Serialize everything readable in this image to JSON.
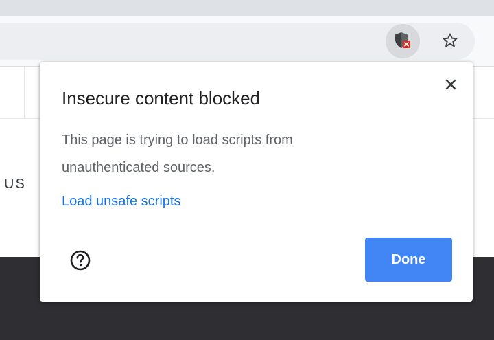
{
  "toolbar": {
    "site_settings_icon": "shield-blocked-icon",
    "bookmark_icon": "star-outline-icon"
  },
  "page": {
    "partial_text": "US"
  },
  "dialog": {
    "title": "Insecure content blocked",
    "body": "This page is trying to load scripts from unauthenticated sources.",
    "link_label": "Load unsafe scripts",
    "done_label": "Done",
    "close_icon": "close-icon",
    "help_icon": "help-icon"
  },
  "colors": {
    "accent": "#4285f4",
    "link": "#1a73e8",
    "blocked_badge": "#d93025",
    "footer": "#2f2f33"
  }
}
